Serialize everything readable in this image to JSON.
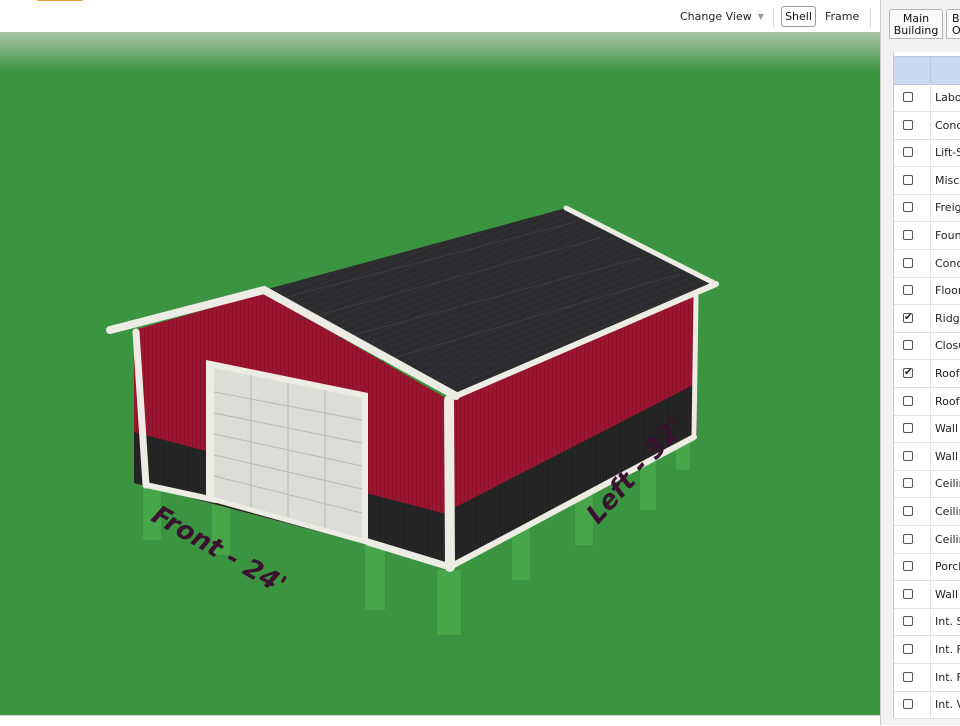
{
  "toolbar": {
    "change_view_label": "Change View",
    "shell_label": "Shell",
    "frame_label": "Frame"
  },
  "panel": {
    "tabs": [
      {
        "line1": "Main",
        "line2": "Building"
      },
      {
        "line1": "Bu",
        "line2": "O"
      }
    ],
    "rows": [
      {
        "label": "Labor",
        "checked": false
      },
      {
        "label": "Conc",
        "checked": false
      },
      {
        "label": "Lift-S",
        "checked": false
      },
      {
        "label": "Misc.",
        "checked": false
      },
      {
        "label": "Freig",
        "checked": false
      },
      {
        "label": "Found",
        "checked": false
      },
      {
        "label": "Conc",
        "checked": false
      },
      {
        "label": "Floor",
        "checked": false
      },
      {
        "label": "Ridge",
        "checked": true
      },
      {
        "label": "Closu",
        "checked": false
      },
      {
        "label": "Roof",
        "checked": true
      },
      {
        "label": "Roof",
        "checked": false
      },
      {
        "label": "Wall",
        "checked": false
      },
      {
        "label": "Wall",
        "checked": false
      },
      {
        "label": "Ceilin",
        "checked": false
      },
      {
        "label": "Ceilin",
        "checked": false
      },
      {
        "label": "Ceilin",
        "checked": false
      },
      {
        "label": "Porch",
        "checked": false
      },
      {
        "label": "Wall",
        "checked": false
      },
      {
        "label": "Int. S",
        "checked": false
      },
      {
        "label": "Int. F",
        "checked": false
      },
      {
        "label": "Int. F",
        "checked": false
      },
      {
        "label": "Int. V",
        "checked": false
      }
    ]
  },
  "scene": {
    "front_label": "Front - 24'",
    "left_label": "Left - 32'",
    "colors": {
      "ground": "#3b943f",
      "roof": "#2a2a2c",
      "wall": "#9b1530",
      "wainscot": "#262626",
      "trim": "#ecebe4",
      "door": "#dcdcd8"
    }
  }
}
